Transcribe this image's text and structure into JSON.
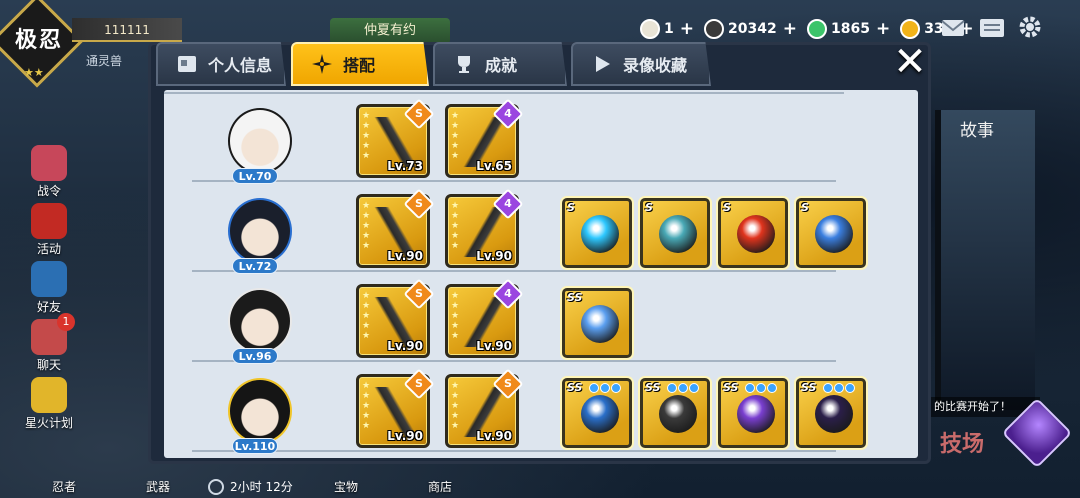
{
  "hud": {
    "logo": "极忍",
    "player_name": "111111",
    "player_sub": "通灵兽",
    "event_banner": "仲夏有约",
    "resources": [
      {
        "name": "rice-ball",
        "value": "1",
        "color": "#e9e4d6"
      },
      {
        "name": "coin",
        "value": "20342",
        "color": "#3a3a3a"
      },
      {
        "name": "jade",
        "value": "1865",
        "color": "#3cc46a"
      },
      {
        "name": "gold-pin",
        "value": "337",
        "color": "#f1b319"
      }
    ]
  },
  "side_menu": [
    {
      "label": "战令",
      "icon": "battle-pass-icon",
      "badge": ""
    },
    {
      "label": "活动",
      "icon": "torii-gate-icon",
      "badge": ""
    },
    {
      "label": "好友",
      "icon": "friend-icon",
      "badge": ""
    },
    {
      "label": "聊天",
      "icon": "chat-icon",
      "badge": "1"
    },
    {
      "label": "星火计划",
      "icon": "star-plan-icon",
      "badge": ""
    }
  ],
  "bottom": {
    "items": [
      "忍者",
      "武器",
      "宝物",
      "商店"
    ],
    "timer": "2小时 12分"
  },
  "story": {
    "label": "故事"
  },
  "arena": {
    "note": "的比赛开始了！",
    "title": "技场"
  },
  "tabs": [
    {
      "label": "个人信息",
      "active": false,
      "icon": "profile-card-icon"
    },
    {
      "label": "搭配",
      "active": true,
      "icon": "shuriken-icon"
    },
    {
      "label": "成就",
      "active": false,
      "icon": "trophy-icon"
    },
    {
      "label": "录像收藏",
      "active": false,
      "icon": "play-icon"
    }
  ],
  "close": "✕",
  "rows": [
    {
      "avatar": "panda-ninja",
      "level": "Lv.70",
      "weapons": [
        {
          "grade": "S",
          "grade_color": "#f08a1a",
          "level": "Lv.73"
        },
        {
          "grade": "4",
          "grade_color": "#9a46e0",
          "level": "Lv.65"
        }
      ],
      "accessories": []
    },
    {
      "avatar": "blue-ribbon-girl",
      "level": "Lv.72",
      "weapons": [
        {
          "grade": "S",
          "grade_color": "#f08a1a",
          "level": "Lv.90"
        },
        {
          "grade": "4",
          "grade_color": "#9a46e0",
          "level": "Lv.90"
        }
      ],
      "accessories": [
        {
          "grade": "S",
          "color": "#2ec8ff"
        },
        {
          "grade": "S",
          "color": "#49a9b6"
        },
        {
          "grade": "S",
          "color": "#e0341d"
        },
        {
          "grade": "S",
          "color": "#3b7fe0"
        }
      ]
    },
    {
      "avatar": "fox-mask-ninja",
      "level": "Lv.96",
      "weapons": [
        {
          "grade": "S",
          "grade_color": "#f08a1a",
          "level": "Lv.90"
        },
        {
          "grade": "4",
          "grade_color": "#9a46e0",
          "level": "Lv.90"
        }
      ],
      "accessories": [
        {
          "grade": "SS",
          "color": "#5b9ff0"
        }
      ]
    },
    {
      "avatar": "duck-hair-girl",
      "level": "Lv.110",
      "weapons": [
        {
          "grade": "S",
          "grade_color": "#f08a1a",
          "level": "Lv.90"
        },
        {
          "grade": "S",
          "grade_color": "#f08a1a",
          "level": "Lv.90"
        }
      ],
      "accessories": [
        {
          "grade": "SS",
          "color": "#2a6fc9"
        },
        {
          "grade": "SS",
          "color": "#3a3a3a"
        },
        {
          "grade": "SS",
          "color": "#7a3fd0"
        },
        {
          "grade": "SS",
          "color": "#2b1f4a"
        }
      ]
    }
  ]
}
